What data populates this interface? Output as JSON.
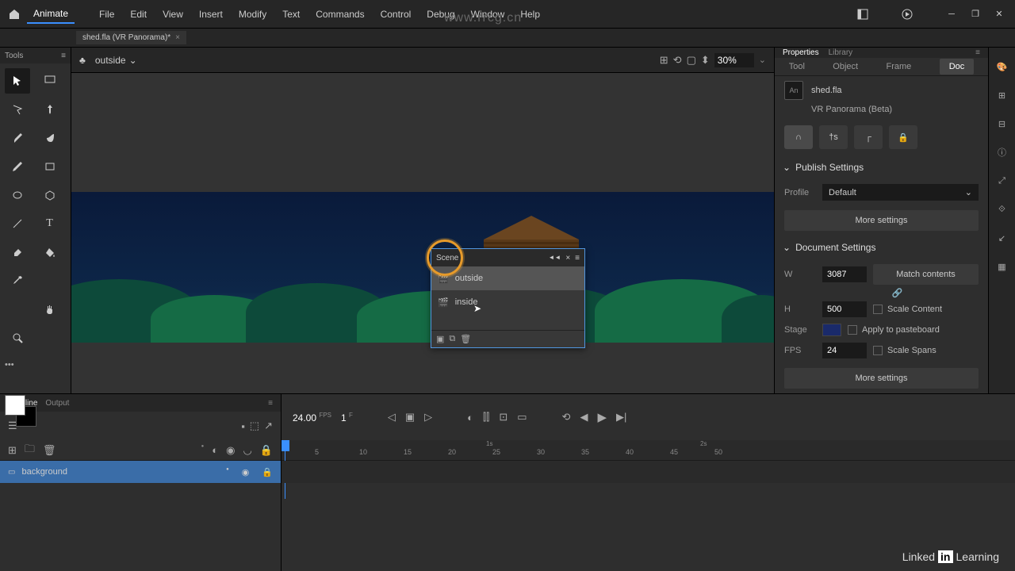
{
  "app": {
    "name": "Animate"
  },
  "menu": [
    "File",
    "Edit",
    "View",
    "Insert",
    "Modify",
    "Text",
    "Commands",
    "Control",
    "Debug",
    "Window",
    "Help"
  ],
  "doc_tab": {
    "name": "shed.fla (VR Panorama)*"
  },
  "tools_panel": {
    "title": "Tools"
  },
  "canvas_bar": {
    "scene": "outside",
    "zoom": "30%"
  },
  "scene_panel": {
    "title": "Scene",
    "items": [
      "outside",
      "inside"
    ],
    "selected": 0
  },
  "props": {
    "tabs": {
      "properties": "Properties",
      "library": "Library"
    },
    "categories": [
      "Tool",
      "Object",
      "Frame",
      "Doc"
    ],
    "active_cat": 3,
    "doc_name": "shed.fla",
    "doc_type": "VR Panorama (Beta)",
    "publish": {
      "title": "Publish Settings",
      "profile_label": "Profile",
      "profile_value": "Default",
      "more": "More settings"
    },
    "document": {
      "title": "Document Settings",
      "w_label": "W",
      "w": "3087",
      "h_label": "H",
      "h": "500",
      "match": "Match contents",
      "scale_content": "Scale Content",
      "stage_label": "Stage",
      "apply_paste": "Apply to pasteboard",
      "fps_label": "FPS",
      "fps": "24",
      "scale_spans": "Scale Spans",
      "more": "More settings"
    }
  },
  "timeline": {
    "tabs": {
      "timeline": "Timeline",
      "output": "Output"
    },
    "fps": "24.00",
    "fps_unit": "FPS",
    "frame": "1",
    "frame_unit": "F",
    "layer": "background",
    "ruler_seconds": [
      "1s",
      "2s"
    ],
    "ruler_frames": [
      "5",
      "10",
      "15",
      "20",
      "25",
      "30",
      "35",
      "40",
      "45",
      "50"
    ]
  },
  "watermark": "www.rrcg.cn",
  "footer": {
    "linkedin": "Linked",
    "in": "in",
    "learning": "Learning"
  }
}
